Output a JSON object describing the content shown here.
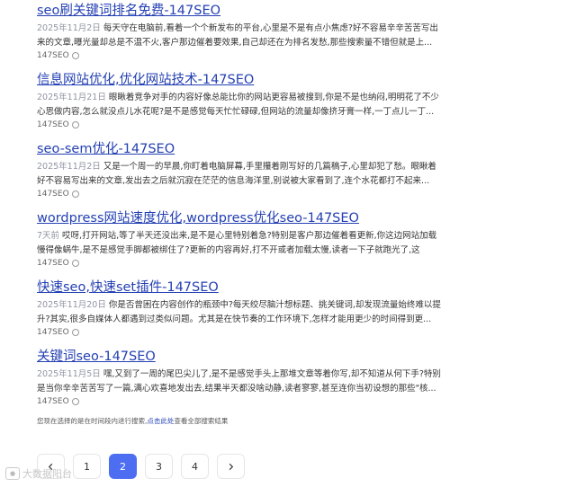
{
  "results": [
    {
      "title": "seo刷关键词排名免费-147SEO",
      "date": "2025年11月2日",
      "snippet": "每天守在电脑前,看着一个个新发布的平台,心里是不是有点小焦虑?好不容易辛辛苦苦写出来的文章,曝光量却总是不温不火,客户那边催着要效果,自己却还在为排名发愁,那些搜索量不错但就是上...",
      "source": "147SEO"
    },
    {
      "title": "信息网站优化,优化网站技术-147SEO",
      "date": "2025年11月21日",
      "snippet": "眼瞅着竞争对手的内容好像总能比你的网站更容易被搜到,你是不是也纳闷,明明花了不少心思做内容,怎么就没点儿水花呢?是不是感觉每天忙忙碌碌,但网站的流量却像挤牙膏一样,一丁点儿一丁...",
      "source": "147SEO"
    },
    {
      "title": "seo-sem优化-147SEO",
      "date": "2025年11月2日",
      "snippet": "又是一个周一的早晨,你盯着电脑屏幕,手里攥着刚写好的几篇稿子,心里却犯了愁。眼瞅着好不容易写出来的文章,发出去之后就沉寂在茫茫的信息海洋里,别说被大家看到了,连个水花都打不起来...",
      "source": "147SEO"
    },
    {
      "title": "wordpress网站速度优化,wordpress优化seo-147SEO",
      "date": "7天前",
      "snippet": "哎呀,打开网站,等了半天还没出来,是不是心里特别着急?特别是客户那边催着看更新,你这边网站加载慢得像蜗牛,是不是感觉手脚都被绑住了?更新的内容再好,打不开或者加载太慢,读者一下子就跑光了,这",
      "source": "147SEO"
    },
    {
      "title": "快速seo,快速set插件-147SEO",
      "date": "2025年11月20日",
      "snippet": "你是否曾困在内容创作的瓶颈中?每天绞尽脑汁想标题、挑关键词,却发现流量始终难以提升?其实,很多自媒体人都遇到过类似问题。尤其是在快节奏的工作环境下,怎样才能用更少的时间得到更...",
      "source": "147SEO"
    },
    {
      "title": "关键词seo-147SEO",
      "date": "2025年11月5日",
      "snippet": "嘿,又到了一周的尾巴尖儿了,是不是感觉手头上那堆文章等着你写,却不知道从何下手?特别是当你辛辛苦苦写了一篇,满心欢喜地发出去,结果半天都没啥动静,读者寥寥,甚至连你当初设想的那些\"核...",
      "source": "147SEO"
    }
  ],
  "note": {
    "prefix": "您现在选择的是在时间段内进行搜索,",
    "link": "点击此处",
    "suffix": "查看全部搜索结果"
  },
  "pagination": {
    "pages": [
      "1",
      "2",
      "3",
      "4"
    ],
    "current": "2"
  },
  "watermark": "大数据阳台",
  "colors": {
    "link": "#2440b3",
    "accent": "#4e6ef2",
    "date": "#9195a3"
  },
  "icons": {
    "prev": "chevron-left-icon",
    "next": "chevron-right-icon"
  }
}
